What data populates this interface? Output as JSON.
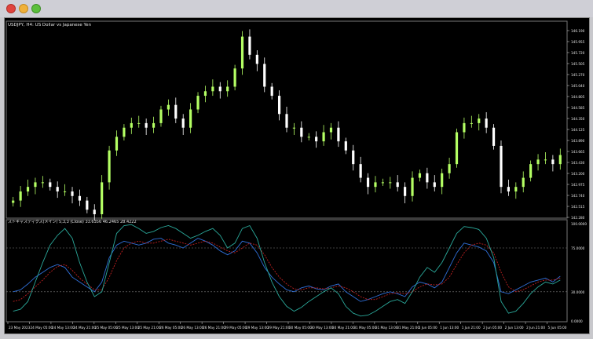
{
  "window": {
    "controls": {
      "close": "close-icon",
      "minimize": "minimize-icon",
      "maximize": "maximize-icon"
    }
  },
  "main_chart": {
    "title": "USDJPY, H4:  US Dollar vs Japanese Yen",
    "y_ticks": [
      "146.190",
      "145.955",
      "145.720",
      "145.505",
      "145.270",
      "145.040",
      "144.805",
      "144.585",
      "144.350",
      "144.125",
      "143.890",
      "143.665",
      "143.430",
      "143.200",
      "142.975",
      "142.740",
      "142.515",
      "142.280"
    ],
    "colors": {
      "bull": "#b4ff64",
      "bear": "#ffffff",
      "background": "#000000"
    }
  },
  "sub_chart": {
    "title": "ストキャスティクス(メイン) 5,3,3 (Close) 33.6356  46.2465  28.4222",
    "levels": [
      75,
      30
    ],
    "y_ticks": [
      "100.0000",
      "75.0000",
      "30.0000",
      "0.0000"
    ],
    "colors": {
      "k_line": "#2f6fd8",
      "d_line": "#c02020",
      "third_line": "#2aa89a",
      "level_line": "#808080"
    }
  },
  "x_axis": {
    "labels": [
      "23 May 2023",
      "24 May 05:00",
      "24 May 13:00",
      "24 May 21:00",
      "25 May 05:00",
      "25 May 13:00",
      "25 May 21:00",
      "26 May 05:00",
      "26 May 13:00",
      "26 May 21:00",
      "29 May 05:00",
      "29 May 13:00",
      "29 May 21:00",
      "30 May 05:00",
      "30 May 13:00",
      "30 May 21:00",
      "31 May 05:00",
      "31 May 13:00",
      "31 May 21:00",
      "1 Jun 05:00",
      "1 Jun 13:00",
      "1 Jun 21:00",
      "2 Jun 05:00",
      "2 Jun 13:00",
      "2 Jun 21:00",
      "5 Jun 05:00"
    ]
  },
  "chart_data": [
    {
      "type": "candlestick",
      "title": "USDJPY, H4:  US Dollar vs Japanese Yen",
      "ylim": [
        142.2,
        146.3
      ],
      "close": [
        142.5,
        142.7,
        142.8,
        142.9,
        142.9,
        142.8,
        142.7,
        142.7,
        142.6,
        142.5,
        142.3,
        142.2,
        142.9,
        143.6,
        143.9,
        144.1,
        144.2,
        144.2,
        144.1,
        144.2,
        144.5,
        144.6,
        144.3,
        144.1,
        144.5,
        144.8,
        144.9,
        145.0,
        144.9,
        145.0,
        145.4,
        146.1,
        145.7,
        145.5,
        145.0,
        144.8,
        144.4,
        144.1,
        144.1,
        143.9,
        143.9,
        143.8,
        144.0,
        144.1,
        143.8,
        143.6,
        143.3,
        143.0,
        142.8,
        142.9,
        142.9,
        142.9,
        142.8,
        142.6,
        143.0,
        143.1,
        142.9,
        142.8,
        143.1,
        143.3,
        144.0,
        144.2,
        144.2,
        144.3,
        144.1,
        143.7,
        142.8,
        142.7,
        142.8,
        143.0,
        143.3,
        143.4,
        143.4,
        143.3,
        143.5
      ]
    },
    {
      "type": "line",
      "title": "ストキャスティクス(メイン) 5,3,3 (Close) 33.6356  46.2465  28.4222",
      "ylim": [
        0,
        100
      ],
      "series": [
        {
          "values": [
            30,
            32,
            38,
            45,
            50,
            55,
            58,
            55,
            45,
            40,
            35,
            30,
            40,
            65,
            78,
            82,
            80,
            78,
            80,
            84,
            85,
            80,
            78,
            75,
            80,
            85,
            82,
            78,
            72,
            68,
            72,
            82,
            80,
            70,
            55,
            45,
            38,
            32,
            30,
            34,
            36,
            33,
            32,
            36,
            38,
            30,
            25,
            20,
            22,
            25,
            28,
            30,
            28,
            25,
            35,
            40,
            38,
            34,
            40,
            55,
            70,
            80,
            78,
            76,
            72,
            60,
            30,
            28,
            32,
            36,
            40,
            42,
            44,
            40,
            46
          ]
        },
        {
          "values": [
            20,
            22,
            28,
            35,
            42,
            50,
            56,
            58,
            52,
            44,
            38,
            32,
            32,
            45,
            62,
            75,
            80,
            82,
            80,
            80,
            82,
            84,
            82,
            80,
            78,
            80,
            82,
            80,
            76,
            72,
            70,
            75,
            80,
            78,
            68,
            55,
            45,
            38,
            33,
            32,
            34,
            34,
            33,
            34,
            36,
            34,
            30,
            25,
            22,
            22,
            25,
            28,
            29,
            28,
            30,
            35,
            38,
            37,
            38,
            45,
            58,
            70,
            78,
            80,
            78,
            70,
            50,
            35,
            30,
            32,
            36,
            40,
            42,
            42,
            44
          ]
        },
        {
          "values": [
            10,
            12,
            20,
            40,
            60,
            78,
            88,
            95,
            85,
            60,
            40,
            25,
            30,
            60,
            90,
            98,
            99,
            95,
            90,
            92,
            96,
            98,
            95,
            90,
            85,
            88,
            92,
            95,
            88,
            75,
            80,
            95,
            98,
            85,
            60,
            40,
            25,
            15,
            10,
            14,
            20,
            25,
            30,
            34,
            28,
            15,
            8,
            5,
            6,
            10,
            15,
            20,
            22,
            18,
            30,
            45,
            55,
            50,
            60,
            75,
            90,
            97,
            96,
            94,
            85,
            65,
            20,
            8,
            10,
            18,
            28,
            35,
            40,
            38,
            42
          ]
        }
      ]
    }
  ]
}
